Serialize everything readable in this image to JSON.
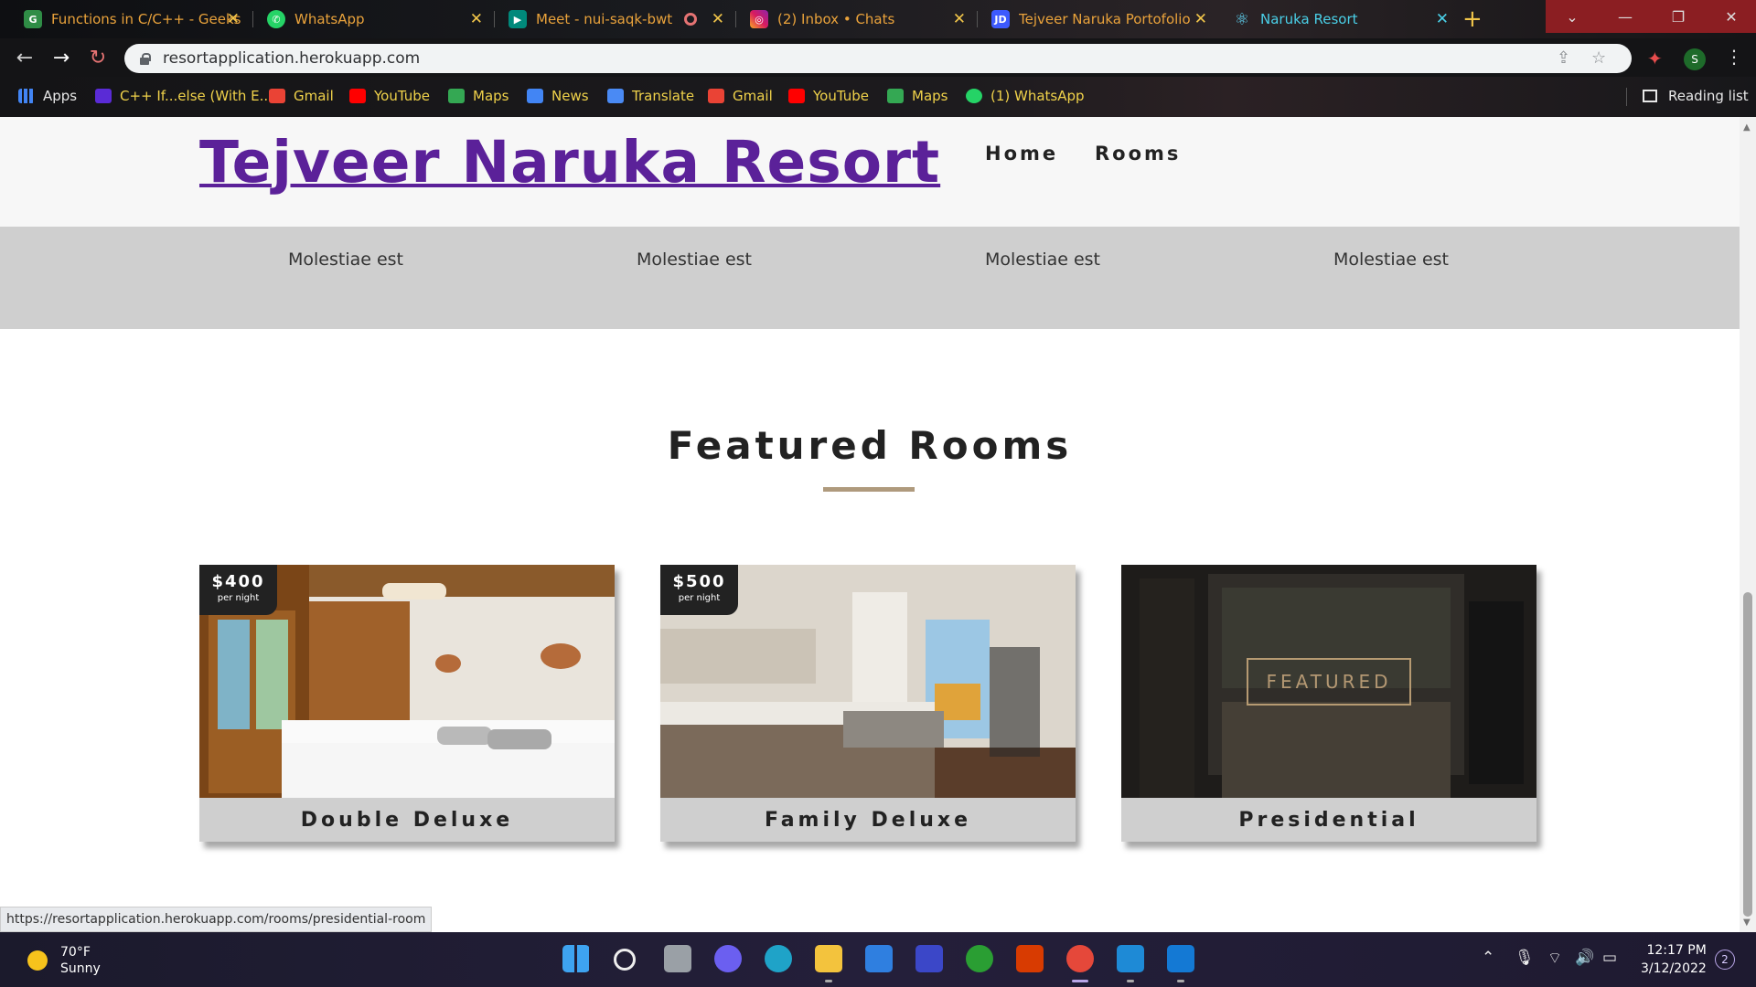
{
  "browser": {
    "tabs": [
      {
        "title": "Functions in C/C++ - Geeks",
        "icon": "geeksforgeeks-icon"
      },
      {
        "title": "WhatsApp",
        "icon": "whatsapp-icon"
      },
      {
        "title": "Meet - nui-saqk-bwt",
        "icon": "google-meet-icon"
      },
      {
        "title": "(2) Inbox • Chats",
        "icon": "instagram-icon"
      },
      {
        "title": "Tejveer Naruka Portofolio",
        "icon": "portfolio-icon"
      },
      {
        "title": "Naruka Resort",
        "icon": "react-icon"
      }
    ],
    "active_tab": "Naruka Resort",
    "url": "resortapplication.herokuapp.com",
    "profile_initial": "S",
    "bookmarks": [
      {
        "label": "Apps",
        "icon": "apps-grid-icon"
      },
      {
        "label": "C++ If...else (With E...",
        "icon": "programiz-icon"
      },
      {
        "label": "Gmail",
        "icon": "gmail-icon"
      },
      {
        "label": "YouTube",
        "icon": "youtube-icon"
      },
      {
        "label": "Maps",
        "icon": "maps-icon"
      },
      {
        "label": "News",
        "icon": "news-icon"
      },
      {
        "label": "Translate",
        "icon": "translate-icon"
      },
      {
        "label": "Gmail",
        "icon": "gmail-icon"
      },
      {
        "label": "YouTube",
        "icon": "youtube-icon"
      },
      {
        "label": "Maps",
        "icon": "maps-icon"
      },
      {
        "label": "(1) WhatsApp",
        "icon": "whatsapp-icon"
      }
    ],
    "reading_list": "Reading list",
    "status_url": "https://resortapplication.herokuapp.com/rooms/presidential-room"
  },
  "site": {
    "brand": "Tejveer Naruka Resort",
    "nav": [
      "Home",
      "Rooms"
    ],
    "services_text": [
      "Molestiae est",
      "Molestiae est",
      "Molestiae est",
      "Molestiae est"
    ],
    "featured_title": "Featured Rooms",
    "rooms": [
      {
        "name": "Double Deluxe",
        "price": "$400",
        "per": "per night"
      },
      {
        "name": "Family Deluxe",
        "price": "$500",
        "per": "per night"
      },
      {
        "name": "Presidential",
        "tag": "FEATURED"
      }
    ],
    "colors": {
      "brand": "#5b2199",
      "accent": "#af9a7d",
      "band": "#cfcfcf"
    }
  },
  "taskbar": {
    "weather_temp": "70°F",
    "weather_desc": "Sunny",
    "time": "12:17 PM",
    "date": "3/12/2022",
    "notifications": "2"
  }
}
